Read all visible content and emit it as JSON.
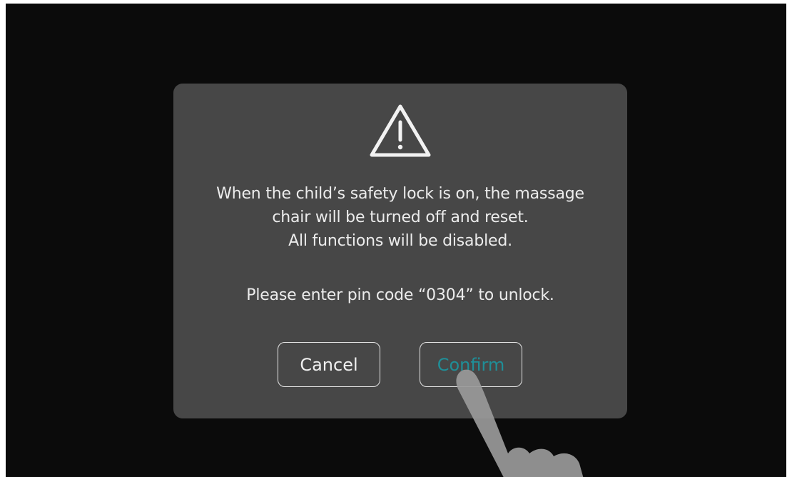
{
  "dialog": {
    "icon": "warning-triangle-icon",
    "message_lines": [
      "When the child’s safety lock is on, the massage",
      "chair will be turned off and reset.",
      "All functions will be disabled."
    ],
    "pin_note": "Please enter pin code “0304” to unlock.",
    "cancel_label": "Cancel",
    "confirm_label": "Confirm"
  },
  "overlay": {
    "icon": "pointing-hand-icon"
  },
  "colors": {
    "screen_bg": "#0b0b0b",
    "dialog_bg": "#474747",
    "text": "#ececec",
    "confirm_accent": "#1f8f98"
  }
}
